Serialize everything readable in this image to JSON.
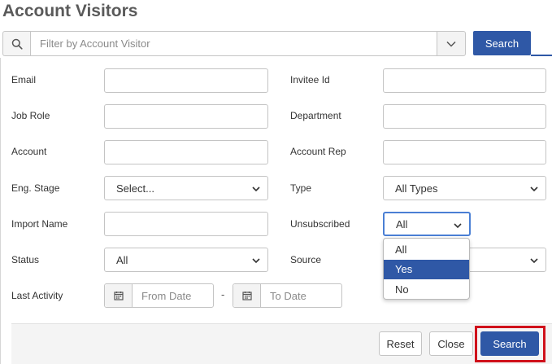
{
  "page": {
    "title": "Account Visitors"
  },
  "search": {
    "placeholder": "Filter by Account Visitor",
    "value": "",
    "button_label": "Search"
  },
  "filters": {
    "email": {
      "label": "Email",
      "value": ""
    },
    "invitee_id": {
      "label": "Invitee Id",
      "value": ""
    },
    "job_role": {
      "label": "Job Role",
      "value": ""
    },
    "department": {
      "label": "Department",
      "value": ""
    },
    "account": {
      "label": "Account",
      "value": ""
    },
    "account_rep": {
      "label": "Account Rep",
      "value": ""
    },
    "eng_stage": {
      "label": "Eng. Stage",
      "selected": "Select..."
    },
    "type": {
      "label": "Type",
      "selected": "All Types"
    },
    "import_name": {
      "label": "Import Name",
      "value": ""
    },
    "unsubscribed": {
      "label": "Unsubscribed",
      "selected": "All",
      "options": [
        "All",
        "Yes",
        "No"
      ],
      "highlighted_option": "Yes"
    },
    "status": {
      "label": "Status",
      "selected": "All"
    },
    "source": {
      "label": "Source",
      "selected": ""
    },
    "last_activity": {
      "label": "Last Activity",
      "from_placeholder": "From Date",
      "to_placeholder": "To Date",
      "separator": "-"
    }
  },
  "footer": {
    "reset_label": "Reset",
    "close_label": "Close",
    "search_label": "Search"
  },
  "colors": {
    "primary": "#2f58a6",
    "highlight_border": "#d0111b",
    "focus_border": "#4a7fd4"
  },
  "icons": {
    "search": "search-icon",
    "caret": "chevron-down-icon",
    "calendar": "calendar-icon"
  }
}
